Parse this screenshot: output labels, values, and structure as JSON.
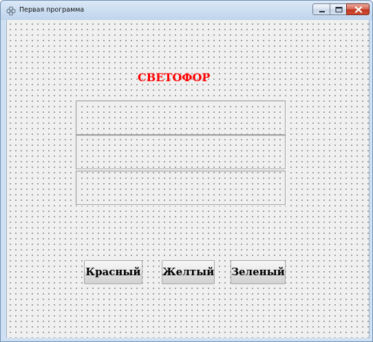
{
  "window": {
    "title": "Первая программа",
    "icon": "app-flower-icon",
    "controls": {
      "minimize_icon": "minimize-icon",
      "maximize_icon": "maximize-icon",
      "close_icon": "close-icon"
    }
  },
  "form": {
    "heading": "СВЕТОФОР",
    "heading_color": "#ff0000",
    "background": "#f0f0f0",
    "panels": [
      "light-panel-red",
      "light-panel-yellow",
      "light-panel-green"
    ],
    "buttons": {
      "red": "Красный",
      "yellow": "Желтый",
      "green": "Зеленый"
    }
  }
}
